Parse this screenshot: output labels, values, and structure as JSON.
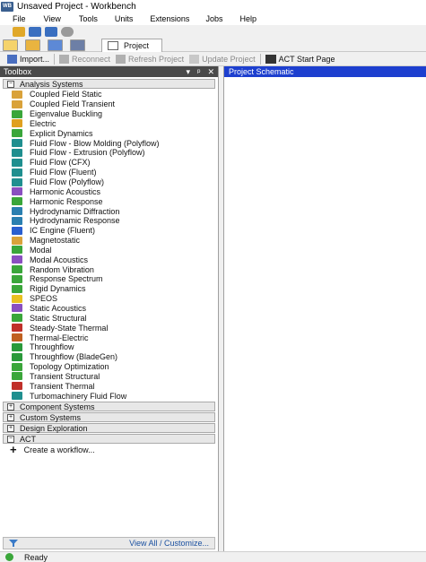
{
  "window": {
    "title": "Unsaved Project - Workbench",
    "app_logo": "WB"
  },
  "menu": {
    "items": [
      "File",
      "View",
      "Tools",
      "Units",
      "Extensions",
      "Jobs",
      "Help"
    ]
  },
  "tabs": {
    "project_label": "Project"
  },
  "toolbar": {
    "import_label": "Import...",
    "reconnect_label": "Reconnect",
    "refresh_label": "Refresh Project",
    "update_label": "Update Project",
    "act_label": "ACT Start Page"
  },
  "toolbox": {
    "title": "Toolbox",
    "header_controls": [
      "▾",
      "ᵖ",
      "✕"
    ],
    "analysis_header": "Analysis Systems",
    "systems": [
      {
        "label": "Coupled Field Static",
        "color": "#d9a23a"
      },
      {
        "label": "Coupled Field Transient",
        "color": "#d9a23a"
      },
      {
        "label": "Eigenvalue Buckling",
        "color": "#3aa63a"
      },
      {
        "label": "Electric",
        "color": "#e0a020"
      },
      {
        "label": "Explicit Dynamics",
        "color": "#3aa63a"
      },
      {
        "label": "Fluid Flow - Blow Molding (Polyflow)",
        "color": "#1f8f8f"
      },
      {
        "label": "Fluid Flow - Extrusion (Polyflow)",
        "color": "#1f8f8f"
      },
      {
        "label": "Fluid Flow (CFX)",
        "color": "#1f8f8f"
      },
      {
        "label": "Fluid Flow (Fluent)",
        "color": "#1f8f8f"
      },
      {
        "label": "Fluid Flow (Polyflow)",
        "color": "#1f8f8f"
      },
      {
        "label": "Harmonic Acoustics",
        "color": "#8a4fc0"
      },
      {
        "label": "Harmonic Response",
        "color": "#3aa63a"
      },
      {
        "label": "Hydrodynamic Diffraction",
        "color": "#2a7fb0"
      },
      {
        "label": "Hydrodynamic Response",
        "color": "#2a7fb0"
      },
      {
        "label": "IC Engine (Fluent)",
        "color": "#2a5fd0"
      },
      {
        "label": "Magnetostatic",
        "color": "#d9a23a"
      },
      {
        "label": "Modal",
        "color": "#3aa63a"
      },
      {
        "label": "Modal Acoustics",
        "color": "#8a4fc0"
      },
      {
        "label": "Random Vibration",
        "color": "#3aa63a"
      },
      {
        "label": "Response Spectrum",
        "color": "#3aa63a"
      },
      {
        "label": "Rigid Dynamics",
        "color": "#3aa63a"
      },
      {
        "label": "SPEOS",
        "color": "#e8c020"
      },
      {
        "label": "Static Acoustics",
        "color": "#8a4fc0"
      },
      {
        "label": "Static Structural",
        "color": "#3aa63a"
      },
      {
        "label": "Steady-State Thermal",
        "color": "#c0302a"
      },
      {
        "label": "Thermal-Electric",
        "color": "#c06020"
      },
      {
        "label": "Throughflow",
        "color": "#2a9a3a"
      },
      {
        "label": "Throughflow (BladeGen)",
        "color": "#2a9a3a"
      },
      {
        "label": "Topology Optimization",
        "color": "#3aa63a"
      },
      {
        "label": "Transient Structural",
        "color": "#3aa63a"
      },
      {
        "label": "Transient Thermal",
        "color": "#c0302a"
      },
      {
        "label": "Turbomachinery Fluid Flow",
        "color": "#1f8f8f"
      }
    ],
    "groups": [
      "Component Systems",
      "Custom Systems",
      "Design Exploration",
      "ACT"
    ],
    "act_item": "Create a workflow...",
    "footer_link": "View All / Customize..."
  },
  "schematic": {
    "title": "Project Schematic"
  },
  "status": {
    "text": "Ready"
  }
}
